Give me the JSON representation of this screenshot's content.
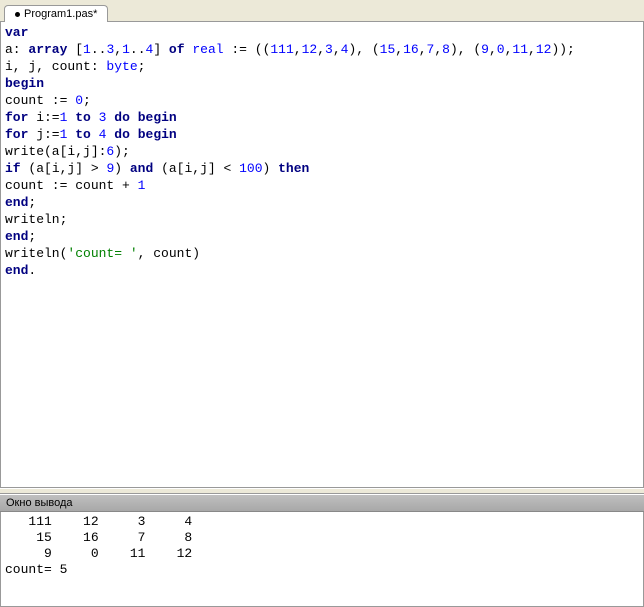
{
  "tab": {
    "title": "Program1.pas*",
    "modified": true
  },
  "code": {
    "tokens": [
      [
        {
          "t": "var",
          "c": "kw"
        }
      ],
      [
        {
          "t": "a: ",
          "c": ""
        },
        {
          "t": "array",
          "c": "kw"
        },
        {
          "t": " [",
          "c": ""
        },
        {
          "t": "1",
          "c": "num"
        },
        {
          "t": "..",
          "c": ""
        },
        {
          "t": "3",
          "c": "num"
        },
        {
          "t": ",",
          "c": ""
        },
        {
          "t": "1",
          "c": "num"
        },
        {
          "t": "..",
          "c": ""
        },
        {
          "t": "4",
          "c": "num"
        },
        {
          "t": "] ",
          "c": ""
        },
        {
          "t": "of",
          "c": "kw"
        },
        {
          "t": " ",
          "c": ""
        },
        {
          "t": "real",
          "c": "type"
        },
        {
          "t": " := ((",
          "c": ""
        },
        {
          "t": "111",
          "c": "num"
        },
        {
          "t": ",",
          "c": ""
        },
        {
          "t": "12",
          "c": "num"
        },
        {
          "t": ",",
          "c": ""
        },
        {
          "t": "3",
          "c": "num"
        },
        {
          "t": ",",
          "c": ""
        },
        {
          "t": "4",
          "c": "num"
        },
        {
          "t": "), (",
          "c": ""
        },
        {
          "t": "15",
          "c": "num"
        },
        {
          "t": ",",
          "c": ""
        },
        {
          "t": "16",
          "c": "num"
        },
        {
          "t": ",",
          "c": ""
        },
        {
          "t": "7",
          "c": "num"
        },
        {
          "t": ",",
          "c": ""
        },
        {
          "t": "8",
          "c": "num"
        },
        {
          "t": "), (",
          "c": ""
        },
        {
          "t": "9",
          "c": "num"
        },
        {
          "t": ",",
          "c": ""
        },
        {
          "t": "0",
          "c": "num"
        },
        {
          "t": ",",
          "c": ""
        },
        {
          "t": "11",
          "c": "num"
        },
        {
          "t": ",",
          "c": ""
        },
        {
          "t": "12",
          "c": "num"
        },
        {
          "t": "));",
          "c": ""
        }
      ],
      [
        {
          "t": "i, j, count: ",
          "c": ""
        },
        {
          "t": "byte",
          "c": "type"
        },
        {
          "t": ";",
          "c": ""
        }
      ],
      [
        {
          "t": "begin",
          "c": "kw"
        }
      ],
      [
        {
          "t": "count := ",
          "c": ""
        },
        {
          "t": "0",
          "c": "num"
        },
        {
          "t": ";",
          "c": ""
        }
      ],
      [
        {
          "t": "for",
          "c": "kw"
        },
        {
          "t": " i:=",
          "c": ""
        },
        {
          "t": "1",
          "c": "num"
        },
        {
          "t": " ",
          "c": ""
        },
        {
          "t": "to",
          "c": "kw"
        },
        {
          "t": " ",
          "c": ""
        },
        {
          "t": "3",
          "c": "num"
        },
        {
          "t": " ",
          "c": ""
        },
        {
          "t": "do",
          "c": "kw"
        },
        {
          "t": " ",
          "c": ""
        },
        {
          "t": "begin",
          "c": "kw"
        }
      ],
      [
        {
          "t": "for",
          "c": "kw"
        },
        {
          "t": " j:=",
          "c": ""
        },
        {
          "t": "1",
          "c": "num"
        },
        {
          "t": " ",
          "c": ""
        },
        {
          "t": "to",
          "c": "kw"
        },
        {
          "t": " ",
          "c": ""
        },
        {
          "t": "4",
          "c": "num"
        },
        {
          "t": " ",
          "c": ""
        },
        {
          "t": "do",
          "c": "kw"
        },
        {
          "t": " ",
          "c": ""
        },
        {
          "t": "begin",
          "c": "kw"
        }
      ],
      [
        {
          "t": "write(a[i,j]:",
          "c": ""
        },
        {
          "t": "6",
          "c": "num"
        },
        {
          "t": ");",
          "c": ""
        }
      ],
      [
        {
          "t": "if",
          "c": "kw"
        },
        {
          "t": " (a[i,j] > ",
          "c": ""
        },
        {
          "t": "9",
          "c": "num"
        },
        {
          "t": ") ",
          "c": ""
        },
        {
          "t": "and",
          "c": "kw"
        },
        {
          "t": " (a[i,j] < ",
          "c": ""
        },
        {
          "t": "100",
          "c": "num"
        },
        {
          "t": ") ",
          "c": ""
        },
        {
          "t": "then",
          "c": "kw"
        }
      ],
      [
        {
          "t": "count := count + ",
          "c": ""
        },
        {
          "t": "1",
          "c": "num"
        }
      ],
      [
        {
          "t": "end",
          "c": "kw"
        },
        {
          "t": ";",
          "c": ""
        }
      ],
      [
        {
          "t": "writeln;",
          "c": ""
        }
      ],
      [
        {
          "t": "end",
          "c": "kw"
        },
        {
          "t": ";",
          "c": ""
        }
      ],
      [
        {
          "t": "writeln(",
          "c": ""
        },
        {
          "t": "'count= '",
          "c": "str"
        },
        {
          "t": ", count)",
          "c": ""
        }
      ],
      [
        {
          "t": "end",
          "c": "kw"
        },
        {
          "t": ".",
          "c": ""
        }
      ]
    ]
  },
  "output": {
    "title": "Окно вывода",
    "lines": [
      "   111    12     3     4",
      "    15    16     7     8",
      "     9     0    11    12",
      "count= 5"
    ]
  }
}
